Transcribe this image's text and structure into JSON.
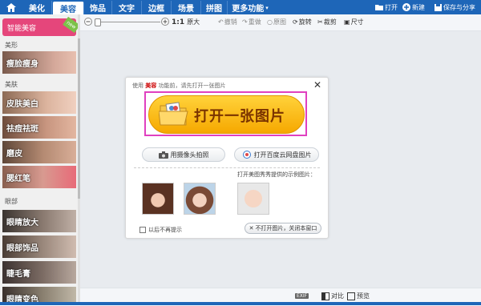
{
  "nav": {
    "tabs": [
      "美化",
      "美容",
      "饰品",
      "文字",
      "边框",
      "场景",
      "拼图",
      "更多功能"
    ],
    "active_tab": "美容",
    "right": {
      "open": "打开",
      "new": "新建",
      "save_share": "保存与分享"
    }
  },
  "toolbar": {
    "ratio": "1:1",
    "original_size": "原大",
    "undo": "撤销",
    "redo": "重做",
    "original": "原图",
    "rotate": "旋转",
    "crop": "裁剪",
    "size": "尺寸"
  },
  "sidebar": {
    "smart_beauty": "智能美容",
    "new_badge": "new",
    "section_shape": "美形",
    "item_slim": "瘦脸瘦身",
    "section_skin": "美肤",
    "item_whiten": "皮肤美白",
    "item_acne": "祛痘祛斑",
    "item_smooth": "磨皮",
    "item_blush": "腮红笔",
    "section_eye": "眼部",
    "item_eye_enlarge": "眼睛放大",
    "item_eye_deco": "眼部饰品",
    "item_mascara": "睫毛膏",
    "item_eye_color": "眼睛变色"
  },
  "dialog": {
    "header_prefix": "使用",
    "header_feature": "美容",
    "header_suffix": "功能前，请先打开一张图片",
    "open_image": "打开一张图片",
    "camera": "用摄像头拍照",
    "cloud": "打开百度云网盘图片",
    "sample_label": "打开美图秀秀提供的示例图片：",
    "dont_show": "以后不再提示",
    "close_without_open": "不打开图片，关闭本窗口"
  },
  "status": {
    "badge": "EXIF",
    "compare": "对比",
    "preview": "预览"
  },
  "colors": {
    "nav_blue": "#1e66b8",
    "smart_pink": "#e5467b",
    "open_yellow": "#ffd23a",
    "highlight_magenta": "#e040c0"
  }
}
